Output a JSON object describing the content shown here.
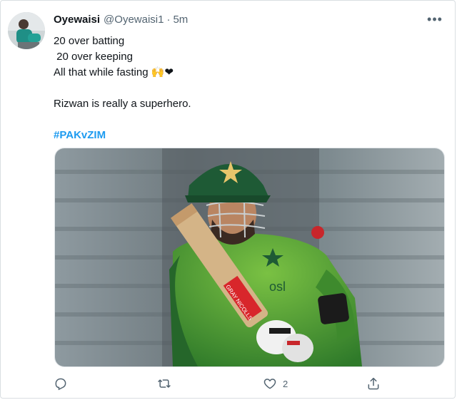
{
  "user": {
    "display_name": "Oyewaisi",
    "handle": "@Oyewaisi1",
    "separator": "·",
    "time": "5m"
  },
  "menu": {
    "more_icon": "more-horizontal-icon",
    "more_label": "•••"
  },
  "tweet": {
    "lines": [
      "20 over batting",
      " 20 over keeping",
      "All that while fasting 🙌❤"
    ],
    "statement": "Rizwan is really a superhero.",
    "hashtag": "#PAKvZIM"
  },
  "media": {
    "sponsor_text": "osl",
    "bat_brand": "GRAY NICOLLS"
  },
  "actions": {
    "reply_icon": "reply-icon",
    "retweet_icon": "retweet-icon",
    "like_icon": "heart-icon",
    "like_count": "2",
    "share_icon": "share-icon"
  },
  "colors": {
    "hashtag": "#1d9bf0",
    "secondary_text": "#536471",
    "jersey_green": "#3e8a2d",
    "cap_green": "#1e5a35"
  }
}
